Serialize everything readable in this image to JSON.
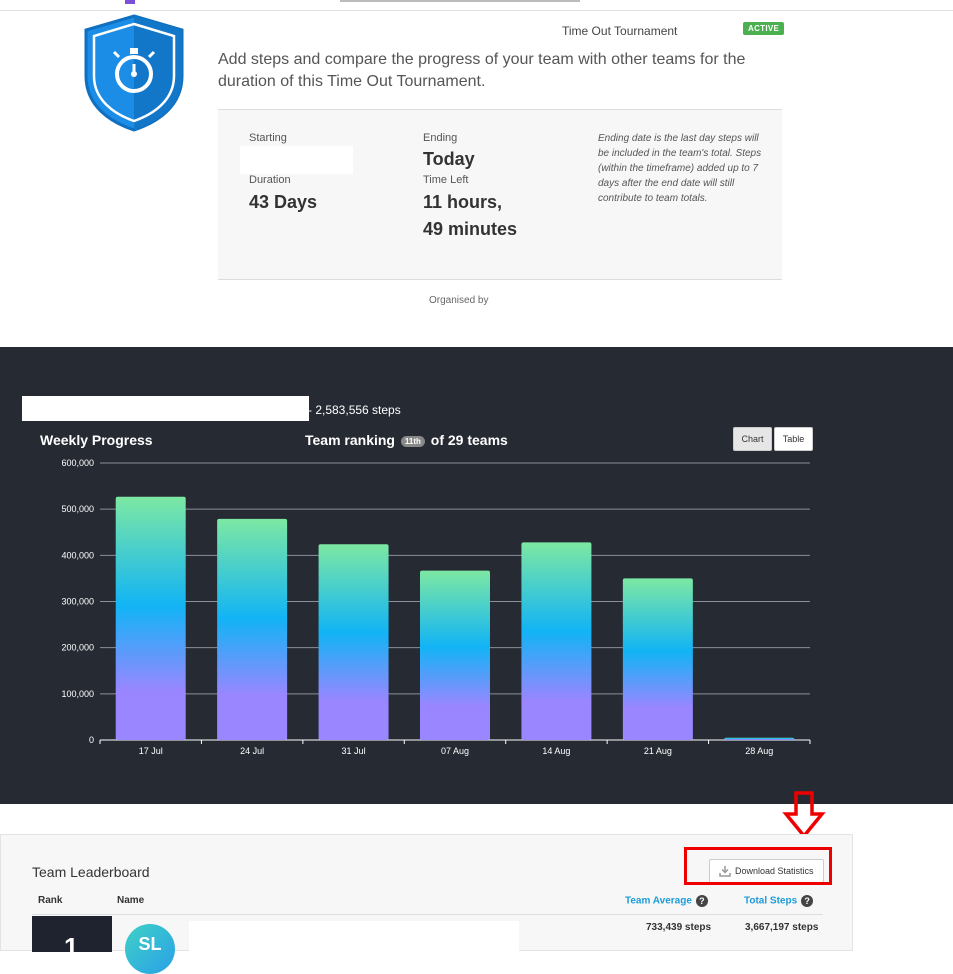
{
  "tournament": {
    "title": "Time Out Tournament",
    "status": "ACTIVE",
    "description": "Add steps and compare the progress of your team with other teams for the duration of this Time Out Tournament.",
    "badge_icon": "stopwatch-icon",
    "starting_label": "Starting",
    "starting_value": "",
    "ending_label": "Ending",
    "ending_value": "Today",
    "duration_label": "Duration",
    "duration_value": "43 Days",
    "time_left_label": "Time Left",
    "time_left_value_line1": "11 hours,",
    "time_left_value_line2": "49 minutes",
    "note": "Ending date is the last day steps will be included in the team's total. Steps (within the timeframe) added up to 7 days after the end date will still contribute to team totals.",
    "organised_by_label": "Organised by"
  },
  "progress": {
    "team_total": "- 2,583,556 steps",
    "weekly_title": "Weekly Progress",
    "ranking_prefix": "Team ranking",
    "ranking_badge": "11th",
    "ranking_suffix": "of 29 teams",
    "toggle_chart": "Chart",
    "toggle_table": "Table"
  },
  "chart_data": {
    "type": "bar",
    "title": "Weekly Progress",
    "categories": [
      "17 Jul",
      "24 Jul",
      "31 Jul",
      "07 Aug",
      "14 Aug",
      "21 Aug",
      "28 Aug"
    ],
    "values": [
      527000,
      479000,
      424000,
      367000,
      428000,
      350000,
      5000
    ],
    "yticks": [
      "0",
      "100,000",
      "200,000",
      "300,000",
      "400,000",
      "500,000",
      "600,000"
    ],
    "ylim": [
      0,
      600000
    ],
    "grid": true,
    "colors": {
      "top": "#7de8a3",
      "middle": "#12b4f5",
      "bottom": "#9a86ff",
      "background": "#262a33"
    }
  },
  "leaderboard": {
    "title": "Team Leaderboard",
    "download_label": "Download Statistics",
    "col_rank": "Rank",
    "col_name": "Name",
    "col_avg": "Team Average",
    "col_total": "Total Steps",
    "help_glyph": "?",
    "rows": [
      {
        "rank": "1",
        "initials": "SL",
        "name": "",
        "avg": "733,439 steps",
        "total": "3,667,197 steps"
      }
    ],
    "accent": "#1e9bd7"
  }
}
